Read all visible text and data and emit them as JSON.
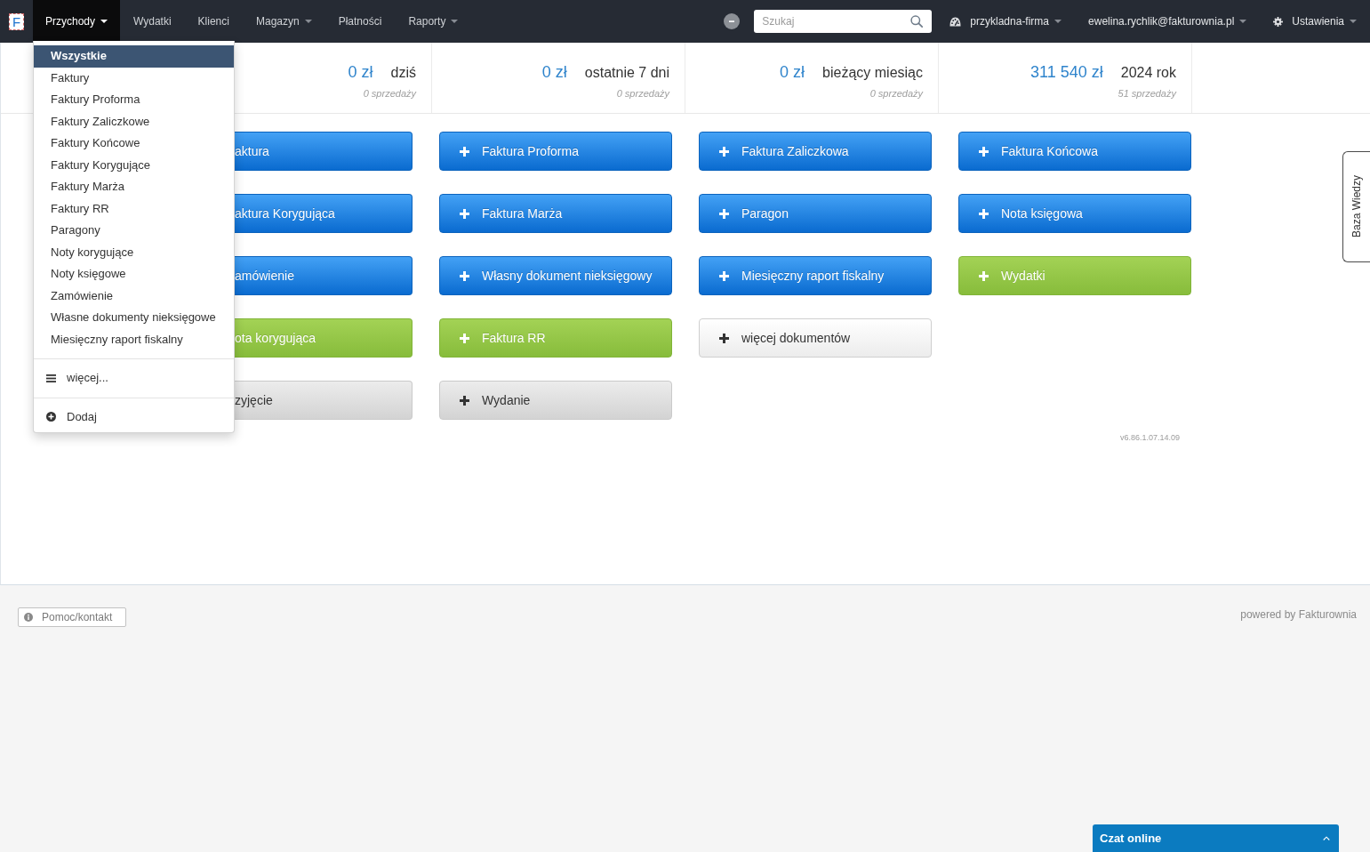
{
  "navbar": {
    "logo": "F",
    "menu": [
      {
        "label": "Przychody",
        "selected": true,
        "caret": true,
        "dropdown": {
          "items": [
            {
              "label": "Wszystkie",
              "selected": true
            },
            {
              "label": "Faktury",
              "selected": false
            },
            {
              "label": "Faktury Proforma",
              "selected": false
            },
            {
              "label": "Faktury Zaliczkowe",
              "selected": false
            },
            {
              "label": "Faktury Końcowe",
              "selected": false
            },
            {
              "label": "Faktury Korygujące",
              "selected": false
            },
            {
              "label": "Faktury Marża",
              "selected": false
            },
            {
              "label": "Faktury RR",
              "selected": false
            },
            {
              "label": "Paragony",
              "selected": false
            },
            {
              "label": "Noty korygujące",
              "selected": false
            },
            {
              "label": "Noty księgowe",
              "selected": false
            },
            {
              "label": "Zamówienie",
              "selected": false
            },
            {
              "label": "Własne dokumenty nieksięgowe",
              "selected": false
            },
            {
              "label": "Miesięczny raport fiskalny",
              "selected": false
            }
          ],
          "actions": [
            {
              "label": "więcej...",
              "kind": "more"
            },
            {
              "label": "Dodaj",
              "kind": "add"
            }
          ]
        }
      },
      {
        "label": "Wydatki",
        "selected": false,
        "caret": false
      },
      {
        "label": "Klienci",
        "selected": false,
        "caret": false
      },
      {
        "label": "Magazyn",
        "selected": false,
        "caret": true
      },
      {
        "label": "Płatności",
        "selected": false,
        "caret": false
      },
      {
        "label": "Raporty",
        "selected": false,
        "caret": true
      }
    ],
    "search": {
      "placeholder": "Szukaj"
    },
    "account": [
      {
        "label": "przykladna-firma",
        "kind": "company",
        "caret": true
      },
      {
        "label": "ewelina.rychlik@fakturownia.pl",
        "kind": "user",
        "caret": true
      },
      {
        "label": "Ustawienia",
        "kind": "settings",
        "caret": true
      }
    ]
  },
  "stats": [
    {
      "amount": "0 zł",
      "period": "dziś",
      "sales": "0 sprzedaży"
    },
    {
      "amount": "0 zł",
      "period": "ostatnie 7 dni",
      "sales": "0 sprzedaży"
    },
    {
      "amount": "0 zł",
      "period": "bieżący miesiąc",
      "sales": "0 sprzedaży"
    },
    {
      "amount": "311 540 zł",
      "period": "2024 rok",
      "sales": "51 sprzedaży"
    }
  ],
  "documents": [
    [
      {
        "label": "aktura",
        "kind": "primary",
        "clipped": true
      },
      {
        "label": "Faktura Proforma",
        "kind": "primary",
        "clipped": false
      },
      {
        "label": "Faktura Zaliczkowa",
        "kind": "primary",
        "clipped": false
      },
      {
        "label": "Faktura Końcowa",
        "kind": "primary",
        "clipped": false
      }
    ],
    [
      {
        "label": "aktura Korygująca",
        "kind": "primary",
        "clipped": true
      },
      {
        "label": "Faktura Marża",
        "kind": "primary",
        "clipped": false
      },
      {
        "label": "Paragon",
        "kind": "primary",
        "clipped": false
      },
      {
        "label": "Nota księgowa",
        "kind": "primary",
        "clipped": false
      }
    ],
    [
      {
        "label": "amówienie",
        "kind": "primary",
        "clipped": true
      },
      {
        "label": "Własny dokument nieksięgowy",
        "kind": "primary",
        "clipped": false
      },
      {
        "label": "Miesięczny raport fiskalny",
        "kind": "primary",
        "clipped": false
      },
      {
        "label": "Wydatki",
        "kind": "success",
        "clipped": false
      }
    ],
    [
      {
        "label": "ota korygująca",
        "kind": "success",
        "clipped": true
      },
      {
        "label": "Faktura RR",
        "kind": "success",
        "clipped": false
      },
      {
        "label": "więcej dokumentów",
        "kind": "light",
        "clipped": false
      }
    ],
    [
      {
        "label": "zyjęcie",
        "kind": "grey",
        "clipped": true
      },
      {
        "label": "Wydanie",
        "kind": "grey",
        "clipped": false
      }
    ]
  ],
  "version": "v6.86.1.07.14.09",
  "side_tab": {
    "label": "Baza Wiedzy"
  },
  "footer": {
    "help": "Pomoc/kontakt",
    "powered_by": "powered by Fakturownia"
  },
  "chat": {
    "title": "Czat online"
  }
}
